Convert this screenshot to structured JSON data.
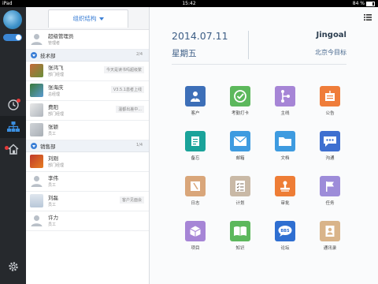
{
  "status": {
    "device": "iPad",
    "time": "15:42",
    "battery": "84 %"
  },
  "org_tab_label": "组织结构",
  "top_user": {
    "name": "超级管理员",
    "title": "管理者"
  },
  "sections": [
    {
      "name": "技术部",
      "count": "2/4",
      "members": [
        {
          "name": "张鸿飞",
          "title": "部门经理",
          "note": "今天是读书吗超级繁"
        },
        {
          "name": "张海庆",
          "title": "总经理",
          "note": "V3.5.1患者上线"
        },
        {
          "name": "费阳",
          "title": "部门经理",
          "note": "温都出差中..."
        },
        {
          "name": "张颖",
          "title": "员工",
          "note": ""
        }
      ]
    },
    {
      "name": "销售部",
      "count": "1/4",
      "members": [
        {
          "name": "刘刚",
          "title": "部门经理",
          "note": ""
        },
        {
          "name": "李伟",
          "title": "员工",
          "note": ""
        },
        {
          "name": "刘磊",
          "title": "员工",
          "note": "客户见面会"
        },
        {
          "name": "许力",
          "title": "员工",
          "note": ""
        }
      ]
    }
  ],
  "header": {
    "date": "2014.07.11",
    "weekday": "星期五",
    "brand": "Jingoal",
    "company": "北京今目标"
  },
  "apps": [
    {
      "label": "客户",
      "icon": "customer-icon",
      "color": "#3d6fb8"
    },
    {
      "label": "考勤打卡",
      "icon": "check-in-icon",
      "color": "#5cb85c"
    },
    {
      "label": "主线",
      "icon": "mainline-icon",
      "color": "#a685d6"
    },
    {
      "label": "公告",
      "icon": "announcement-icon",
      "color": "#ef7d3a"
    },
    {
      "label": "备忘",
      "icon": "memo-icon",
      "color": "#1aa39a"
    },
    {
      "label": "邮箱",
      "icon": "mail-icon",
      "color": "#3e9be0"
    },
    {
      "label": "文档",
      "icon": "folder-icon",
      "color": "#3e9be0"
    },
    {
      "label": "沟通",
      "icon": "chat-icon",
      "color": "#3e6fd0"
    },
    {
      "label": "日志",
      "icon": "journal-icon",
      "color": "#d9a67a"
    },
    {
      "label": "计划",
      "icon": "plan-icon",
      "color": "#c9b9a6"
    },
    {
      "label": "审批",
      "icon": "approval-stamp-icon",
      "color": "#ee7d36"
    },
    {
      "label": "任务",
      "icon": "task-flag-icon",
      "color": "#9d8cd9"
    },
    {
      "label": "项目",
      "icon": "project-box-icon",
      "color": "#a685d6"
    },
    {
      "label": "知识",
      "icon": "knowledge-book-icon",
      "color": "#5cb85c"
    },
    {
      "label": "论坛",
      "icon": "forum-bbs-icon",
      "color": "#2f6fd1"
    },
    {
      "label": "通讯录",
      "icon": "contacts-icon",
      "color": "#d9b48a"
    }
  ]
}
